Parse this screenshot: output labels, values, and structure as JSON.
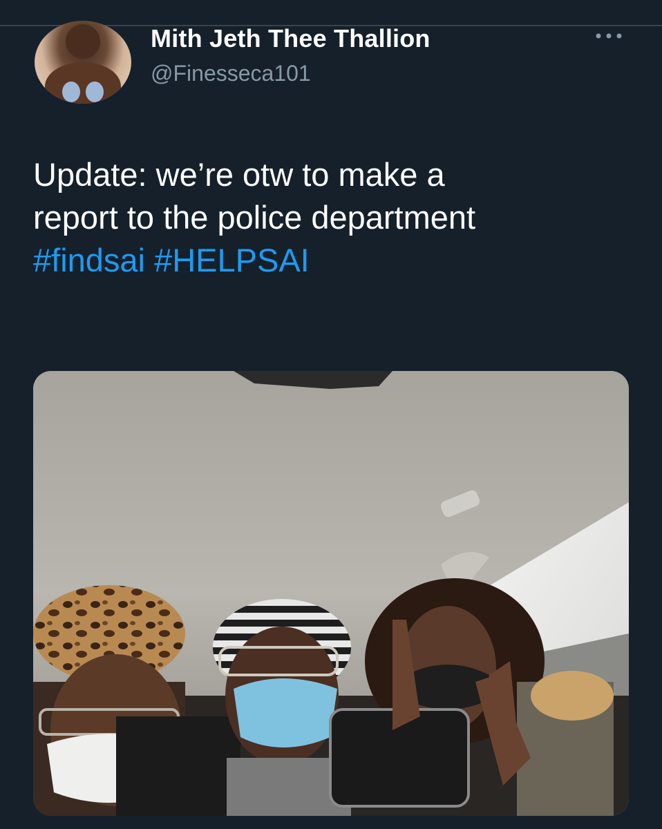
{
  "tweet": {
    "display_name": "Mith Jeth Thee Thallion",
    "handle": "@Finesseca101",
    "more_icon": "more-horizontal-icon",
    "text_line_1": "Update: we’re otw to make a",
    "text_line_2": "report to the police department",
    "hashtag_1": "#findsai",
    "hashtag_2": "#HELPSAI",
    "colors": {
      "background": "#15202b",
      "primary_text": "#ffffff",
      "secondary_text": "#8899a6",
      "hashtag": "#1d9bf0"
    }
  }
}
